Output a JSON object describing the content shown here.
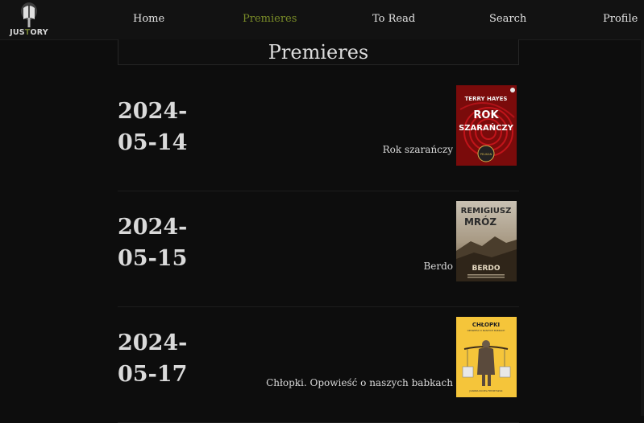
{
  "logo": {
    "text_prefix": "JUS",
    "text_o": "T",
    "text_suffix": "ORY"
  },
  "nav": {
    "home": "Home",
    "premieres": "Premieres",
    "to_read": "To Read",
    "search": "Search",
    "profile": "Profile",
    "active": "premieres"
  },
  "page": {
    "title": "Premieres"
  },
  "premieres": [
    {
      "date_year": "2024-",
      "date_rest": "05-14",
      "title": "Rok szarańczy",
      "cover": {
        "author": "TERRY HAYES",
        "line1": "ROK",
        "line2": "SZARAŃCZY",
        "badge": "PELIKAN"
      }
    },
    {
      "date_year": "2024-",
      "date_rest": "05-15",
      "title": "Berdo",
      "cover": {
        "author_line1": "REMIGIUSZ",
        "author_line2": "MRÓZ",
        "title": "BERDO"
      }
    },
    {
      "date_year": "2024-",
      "date_rest": "05-17",
      "title": "Chłopki. Opowieść o naszych babkach",
      "cover": {
        "title": "CHŁOPKI",
        "subtitle": "OPOWIEŚĆ O NASZYCH BABKACH",
        "author": "JOANNA KUCIEL-FRYDRYSZAK"
      }
    }
  ],
  "colors": {
    "background": "#0d0d0d",
    "navbar": "#121212",
    "accent": "#7a8c28",
    "text": "#d6d6d6"
  }
}
